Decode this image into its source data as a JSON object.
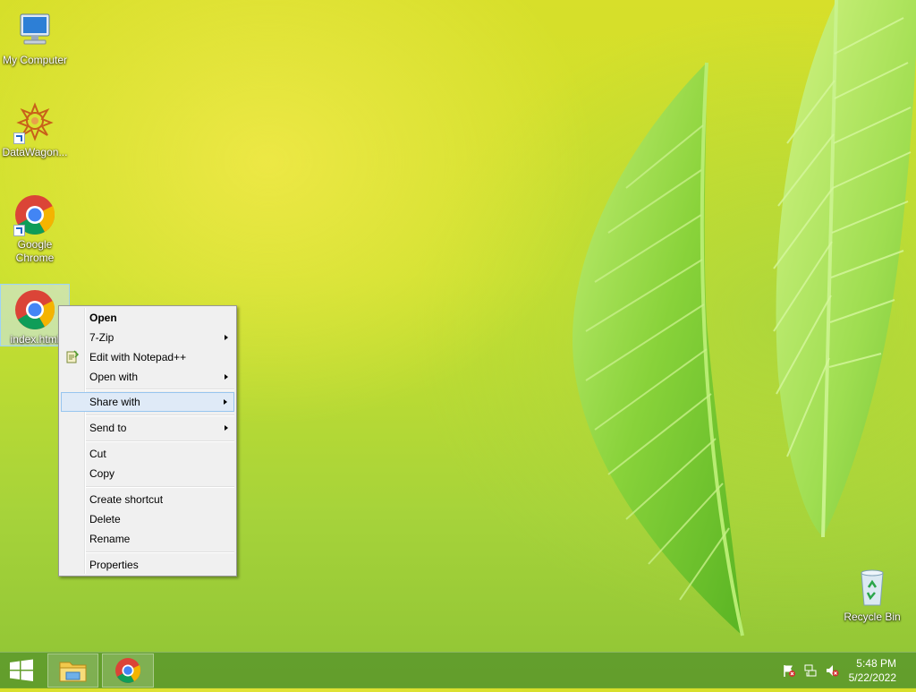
{
  "desktop": {
    "icons": [
      {
        "label": "My Computer"
      },
      {
        "label": "DataWagon..."
      },
      {
        "label": "Google Chrome"
      },
      {
        "label": "index.html"
      },
      {
        "label": "Recycle Bin"
      }
    ]
  },
  "context_menu": {
    "items": [
      {
        "label": "Open"
      },
      {
        "label": "7-Zip"
      },
      {
        "label": "Edit with Notepad++"
      },
      {
        "label": "Open with"
      },
      {
        "label": "Share with"
      },
      {
        "label": "Send to"
      },
      {
        "label": "Cut"
      },
      {
        "label": "Copy"
      },
      {
        "label": "Create shortcut"
      },
      {
        "label": "Delete"
      },
      {
        "label": "Rename"
      },
      {
        "label": "Properties"
      }
    ]
  },
  "taskbar": {
    "clock_time": "5:48 PM",
    "clock_date": "5/22/2022",
    "icons": [
      "windows-start-icon",
      "file-explorer-icon",
      "chrome-icon",
      "action-center-flag-icon",
      "network-icon",
      "volume-muted-icon"
    ]
  },
  "colors": {
    "taskbar": "#56942a",
    "menu_background": "#f0f0f0",
    "menu_highlight": "#dfeaf7",
    "selection": "#cde8ff"
  }
}
